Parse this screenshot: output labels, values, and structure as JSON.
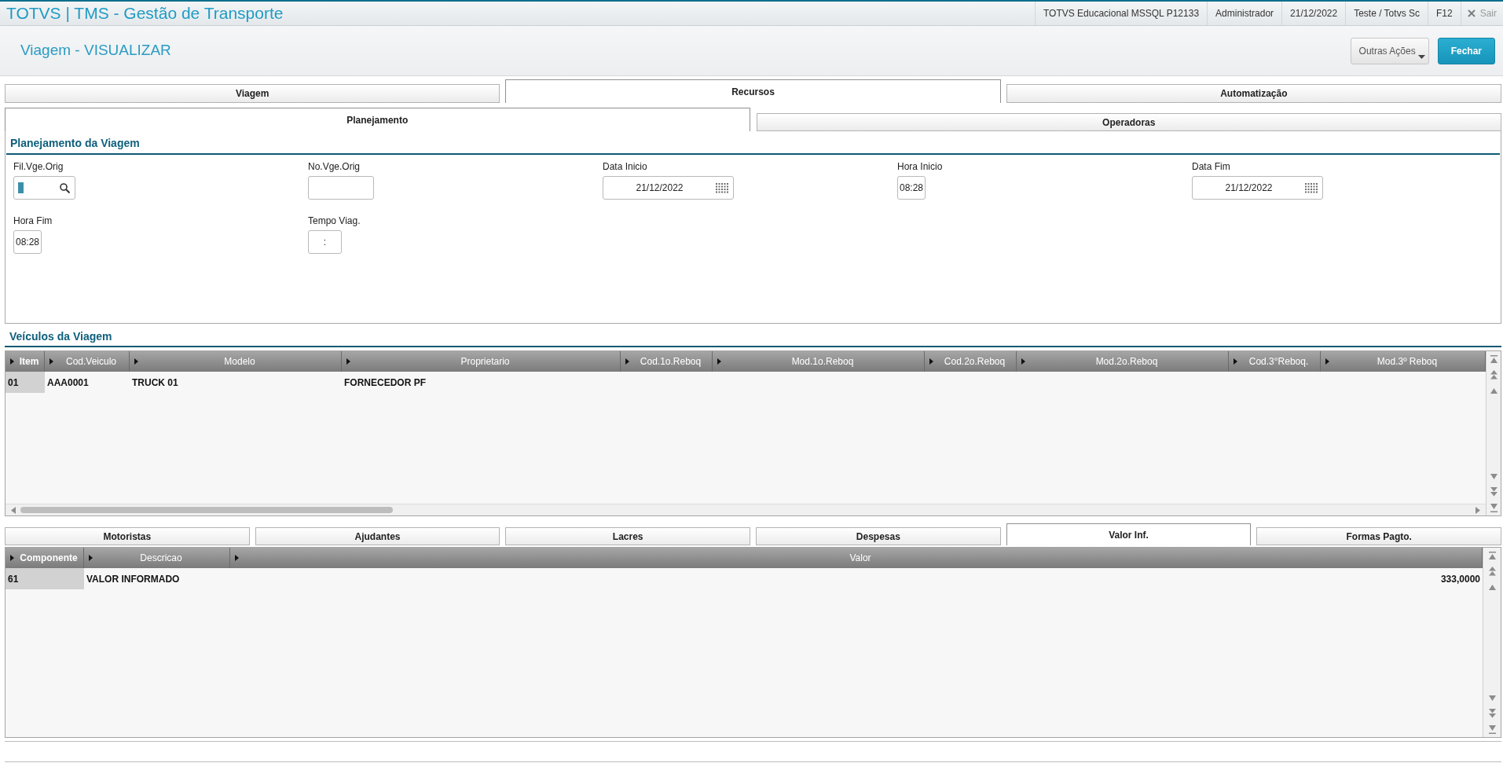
{
  "app_bar": {
    "title": "TOTVS | TMS - Gestão de Transporte",
    "info": [
      "TOTVS Educacional MSSQL P12133",
      "Administrador",
      "21/12/2022",
      "Teste / Totvs Sc",
      "F12"
    ],
    "exit_label": "Sair"
  },
  "page_header": {
    "title": "Viagem - VISUALIZAR",
    "buttons": [
      {
        "label": "Outras Ações",
        "kind": "menu"
      },
      {
        "label": "Fechar",
        "kind": "primary"
      }
    ]
  },
  "tabs": [
    {
      "label": "Viagem",
      "selected": false
    },
    {
      "label": "Recursos",
      "selected": true
    },
    {
      "label": "Automatização",
      "selected": false
    }
  ],
  "subtabs": [
    {
      "label": "Planejamento",
      "selected": true
    },
    {
      "label": "Operadoras",
      "selected": false
    }
  ],
  "planning": {
    "title": "Planejamento da Viagem",
    "fields": [
      {
        "label": "Fil.Vge.Orig",
        "kind": "lookup",
        "focused": true
      },
      {
        "label": "No.Vge.Orig",
        "kind": "text",
        "focused": false
      },
      {
        "label": "Data Inicio",
        "kind": "date",
        "value": "21/12/2022",
        "focused": false
      },
      {
        "label": "Hora Inicio",
        "kind": "time",
        "value": "08:28",
        "focused": false
      },
      {
        "label": "Data Fim",
        "kind": "date",
        "value": "21/12/2022",
        "focused": false
      },
      {
        "label": "Hora Fim",
        "kind": "time",
        "value": "08:28",
        "focused": false
      },
      {
        "label": "Tempo Viag.",
        "kind": "duration",
        "value": ":",
        "focused": false
      }
    ]
  },
  "vehicles": {
    "title": "Veículos da Viagem",
    "columns": [
      {
        "label": "Item",
        "sorted": true
      },
      {
        "label": "Cod.Veiculo",
        "sorted": false
      },
      {
        "label": "Modelo",
        "sorted": false
      },
      {
        "label": "Proprietario",
        "sorted": false
      },
      {
        "label": "Cod.1o.Reboq",
        "sorted": false
      },
      {
        "label": "Mod.1o.Reboq",
        "sorted": false
      },
      {
        "label": "Cod.2o.Reboq",
        "sorted": false
      },
      {
        "label": "Mod.2o.Reboq",
        "sorted": false
      },
      {
        "label": "Cod.3°Reboq.",
        "sorted": false
      },
      {
        "label": "Mod.3º Reboq",
        "sorted": false
      }
    ],
    "rows": [
      {
        "cells": [
          {
            "text": "01",
            "selected": true
          },
          {
            "text": "AAA0001",
            "selected": false
          },
          {
            "text": "TRUCK 01",
            "selected": false
          },
          {
            "text": "FORNECEDOR PF",
            "selected": false
          }
        ]
      }
    ]
  },
  "detail_tabs": [
    {
      "label": "Motoristas",
      "selected": false
    },
    {
      "label": "Ajudantes",
      "selected": false
    },
    {
      "label": "Lacres",
      "selected": false
    },
    {
      "label": "Despesas",
      "selected": false
    },
    {
      "label": "Valor Inf.",
      "selected": true
    },
    {
      "label": "Formas Pagto.",
      "selected": false
    }
  ],
  "components": {
    "columns": [
      {
        "label": "Componente",
        "sorted": true,
        "kind": "text"
      },
      {
        "label": "Descricao",
        "sorted": false,
        "kind": "text"
      },
      {
        "label": "Valor",
        "sorted": false,
        "kind": "number"
      }
    ],
    "rows": [
      {
        "cells": [
          {
            "text": "61",
            "selected": true
          },
          {
            "text": "VALOR INFORMADO",
            "selected": false
          },
          {
            "text": "333,0000",
            "selected": false
          }
        ]
      }
    ]
  }
}
